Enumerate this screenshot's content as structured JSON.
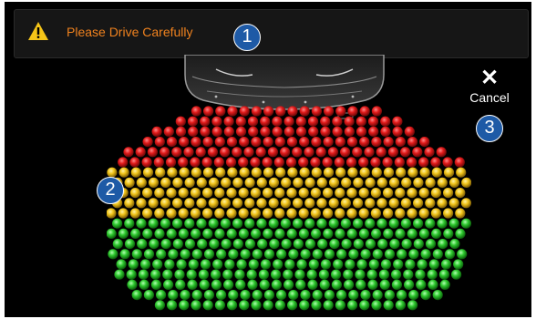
{
  "warning": {
    "icon": "warning-icon",
    "text": "Please Drive Carefully",
    "text_color": "#f0821e",
    "icon_color": "#f5c518"
  },
  "cancel": {
    "icon": "close-icon",
    "label": "Cancel"
  },
  "callouts": [
    "1",
    "2",
    "3"
  ],
  "sensor": {
    "zone_colors": {
      "near": "#e21a1a",
      "mid": "#f0c419",
      "far": "#2ec82e"
    }
  },
  "colors": {
    "background": "#000000",
    "callout": "#1e5aa6"
  }
}
